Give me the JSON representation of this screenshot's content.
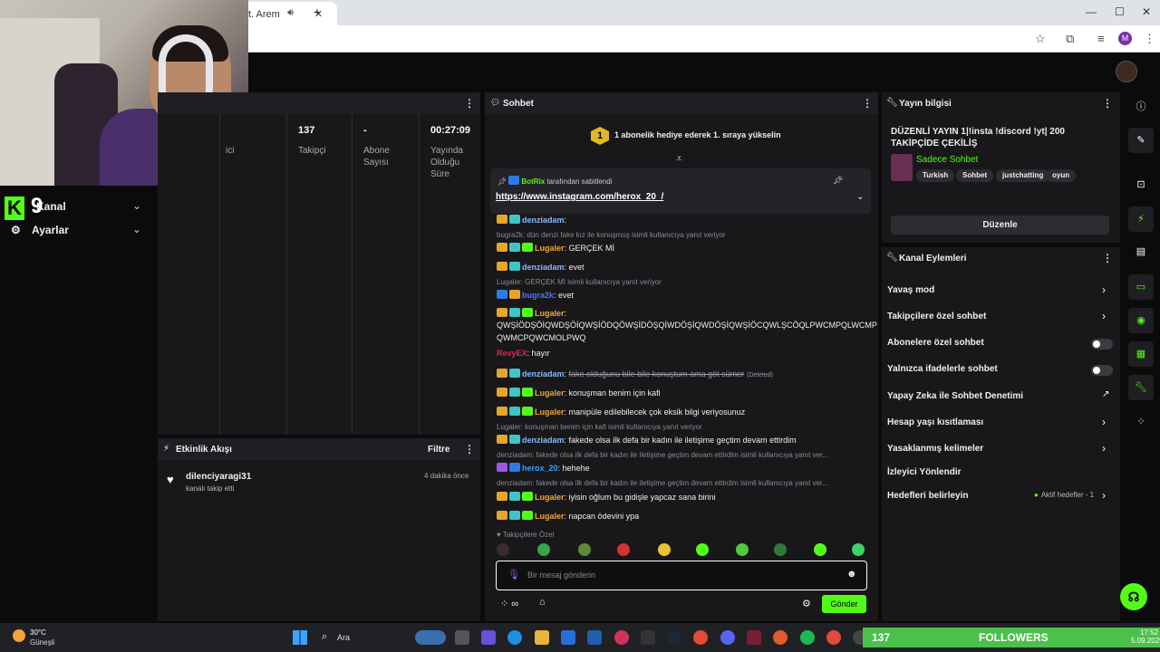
{
  "browser": {
    "tab_title": "t. Arem",
    "new_tab": "+",
    "profile_initial": "M"
  },
  "sidebar": {
    "logo": "K",
    "overlay_number": "9",
    "items": [
      {
        "label": "Kanal"
      },
      {
        "label": "Ayarlar"
      }
    ]
  },
  "stats": {
    "cols": [
      {
        "value": "",
        "label": "ici"
      },
      {
        "value": "137",
        "label": "Takipçi"
      },
      {
        "value": "-",
        "label": "Abone Sayısı"
      },
      {
        "value": "00:27:09",
        "label": "Yayında Olduğu Süre"
      }
    ]
  },
  "events": {
    "title": "Etkinlik Akışı",
    "filter": "Filtre",
    "items": [
      {
        "user": "dilenciyaragi31",
        "action": "kanalı takip etti",
        "time": "4 dakika önce"
      }
    ]
  },
  "chat": {
    "title": "Sohbet",
    "gift_rank": "1",
    "gift_text": "1 abonelik hediye ederek 1. sıraya yükselin",
    "pinned": {
      "by_user": "BotRix",
      "by_text": "tarafından sabitlendi",
      "link": "https://www.instagram.com/herox_20_/"
    },
    "messages": [
      {
        "type": "msg",
        "user": "denziadam",
        "text": ""
      },
      {
        "type": "reply",
        "text": "bugra2k: dün denzi fake kız ile konuşmuş isimli kullanıcıya yanıt veriyor"
      },
      {
        "type": "msg",
        "user": "Lugaler",
        "text": "GERÇEK Mİ"
      },
      {
        "type": "msg",
        "user": "denziadam",
        "text": "evet"
      },
      {
        "type": "reply",
        "text": "Lugaler: GERÇEK Mİ isimli kullanıcıya yanıt veriyor"
      },
      {
        "type": "msg",
        "user": "bugra2k",
        "text": "evet"
      },
      {
        "type": "msg",
        "user": "Lugaler",
        "text": ""
      },
      {
        "type": "msg",
        "user": "",
        "text": "QWŞİÖDŞÖİQWDŞÖİQWŞİÖDQÖWŞİDÖŞQİWDÖŞİQWDÖŞİQWŞİÖCQWLŞCÖQLPWCMPQLWCMP"
      },
      {
        "type": "msg",
        "user": "",
        "text": "QWMCPQWCMOLPWQ"
      },
      {
        "type": "msg",
        "user": "RevyEX",
        "text": "hayır"
      },
      {
        "type": "msg",
        "user": "denziadam",
        "text": "fake olduğunu bile bile konuştum ama göt sümer",
        "deleted": "(Deleted)"
      },
      {
        "type": "msg",
        "user": "Lugaler",
        "text": "konuşman benim için kafi"
      },
      {
        "type": "msg",
        "user": "Lugaler",
        "text": "manipüle edilebilecek çok eksik bilgi veriyosunuz"
      },
      {
        "type": "reply",
        "text": "Lugaler: konuşman benim için kafi isimli kullanıcıya yanıt veriyor"
      },
      {
        "type": "msg",
        "user": "denziadam",
        "text": "fakede olsa ilk defa bir kadın ile iletişime geçtim devam ettirdim"
      },
      {
        "type": "reply",
        "text": "denziadam: fakede olsa ilk defa bir kadın ile iletişime geçtim devam ettirdim isimli kullanıcıya yanıt ver..."
      },
      {
        "type": "msg",
        "user": "herox_20",
        "text": "hehehe"
      },
      {
        "type": "reply",
        "text": "denziadam: fakede olsa ilk defa bir kadın ile iletişime geçtim devam ettirdim isimli kullanıcıya yanıt ver..."
      },
      {
        "type": "msg",
        "user": "Lugaler",
        "text": "iyisin oğlum bu gidişle yapcaz sana birini"
      },
      {
        "type": "msg",
        "user": "Lugaler",
        "text": "napcan ödevini ypa"
      }
    ],
    "followers_only": "Takipçilere Özel",
    "input_placeholder": "Bir mesaj gönderin",
    "send": "Gönder"
  },
  "stream_info": {
    "title": "Yayın bilgisi",
    "stream_title": "DÜZENLİ YAYIN 1|!insta !discord !yt| 200 TAKİPÇİDE ÇEKİLİŞ",
    "category": "Sadece Sohbet",
    "tags": [
      "Turkish",
      "Sohbet",
      "justchatting",
      "oyun"
    ],
    "edit": "Düzenle"
  },
  "channel_actions": {
    "title": "Kanal Eylemleri",
    "items": [
      {
        "label": "Yavaş mod",
        "control": "chevron"
      },
      {
        "label": "Takipçilere özel sohbet",
        "control": "chevron"
      },
      {
        "label": "Abonelere özel sohbet",
        "control": "toggle"
      },
      {
        "label": "Yalnızca ifadelerle sohbet",
        "control": "toggle"
      },
      {
        "label": "Yapay Zeka ile Sohbet Denetimi",
        "control": "external"
      },
      {
        "label": "Hesap yaşı kısıtlaması",
        "control": "chevron"
      },
      {
        "label": "Yasaklanmış kelimeler",
        "control": "chevron"
      },
      {
        "label": "İzleyici Yönlendir",
        "control": "none"
      },
      {
        "label": "Hedefleri belirleyin",
        "control": "chevron"
      }
    ],
    "active_goals": "Aktif hedefler - 1"
  },
  "taskbar": {
    "temp": "30°C",
    "condition": "Güneşli",
    "search": "Ara",
    "followers_count": "137",
    "followers_label": "FOLLOWERS",
    "time": "17:52",
    "date": "5.09.2025"
  },
  "colors": {
    "accent": "#53fc18",
    "panel": "#18181b",
    "background": "#0b0b0c"
  }
}
